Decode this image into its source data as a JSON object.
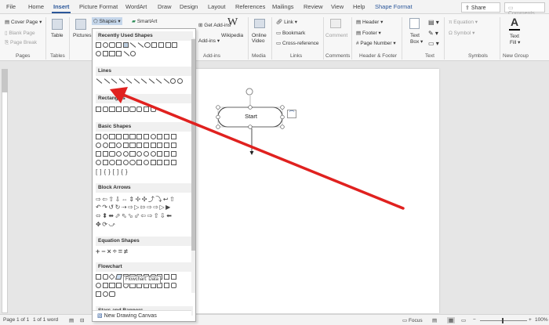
{
  "tabs": [
    {
      "label": "File"
    },
    {
      "label": "Home"
    },
    {
      "label": "Insert"
    },
    {
      "label": "Picture Format"
    },
    {
      "label": "WordArt"
    },
    {
      "label": "Draw"
    },
    {
      "label": "Design"
    },
    {
      "label": "Layout"
    },
    {
      "label": "References"
    },
    {
      "label": "Mailings"
    },
    {
      "label": "Review"
    },
    {
      "label": "View"
    },
    {
      "label": "Help"
    },
    {
      "label": "Shape Format"
    }
  ],
  "share_label": "Share",
  "comments_label": "Comments",
  "ribbon": {
    "pages": {
      "items": [
        "Cover Page",
        "Blank Page",
        "Page Break"
      ],
      "label": "Pages"
    },
    "tables": {
      "table": "Table",
      "label": "Tables"
    },
    "illustrations": {
      "pictures": "Pictures",
      "shapes": "Shapes",
      "smartart": "SmartArt"
    },
    "addins": {
      "get": "Get Add-ins",
      "my": "Add-ins",
      "wikipedia": "Wikipedia",
      "label": "Add-ins"
    },
    "media": {
      "online_video_1": "Online",
      "online_video_2": "Video",
      "label": "Media"
    },
    "links": {
      "link": "Link",
      "bookmark": "Bookmark",
      "cross": "Cross-reference",
      "label": "Links"
    },
    "comments": {
      "comment": "Comment",
      "label": "Comments"
    },
    "header_footer": {
      "header": "Header",
      "footer": "Footer",
      "page_number": "Page Number",
      "label": "Header & Footer"
    },
    "text": {
      "textbox_1": "Text",
      "textbox_2": "Box",
      "label": "Text"
    },
    "symbols": {
      "equation": "Equation",
      "symbol": "Symbol",
      "label": "Symbols"
    },
    "new_group": {
      "text_fill_1": "Text",
      "text_fill_2": "Fill",
      "label": "New Group"
    }
  },
  "shapes_panel": {
    "sections": [
      {
        "title": "Recently Used Shapes"
      },
      {
        "title": "Lines"
      },
      {
        "title": "Rectangles"
      },
      {
        "title": "Basic Shapes"
      },
      {
        "title": "Block Arrows"
      },
      {
        "title": "Equation Shapes"
      },
      {
        "title": "Flowchart"
      },
      {
        "title": "Stars and Banners"
      }
    ],
    "tooltip": "Flowchart: Data",
    "new_canvas": "New Drawing Canvas"
  },
  "document": {
    "shape_text": "Start"
  },
  "status": {
    "page": "Page 1 of 1",
    "words": "1 of 1 word",
    "focus": "Focus",
    "zoom": "100%"
  },
  "colors": {
    "accent": "#2b579a",
    "arrow": "#e0211f"
  }
}
